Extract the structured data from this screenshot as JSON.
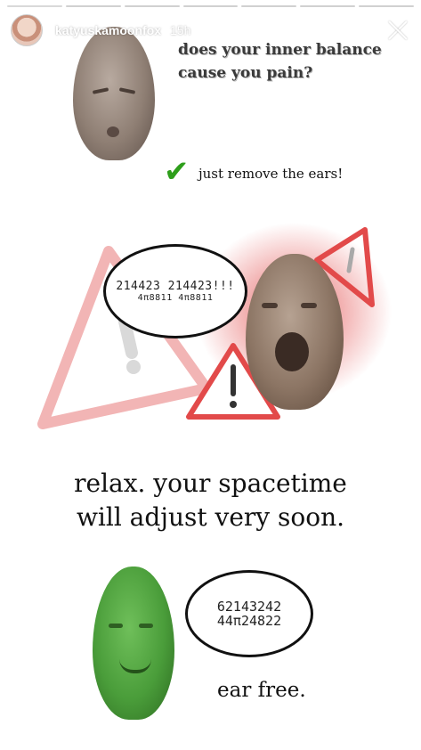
{
  "header": {
    "username": "katyuskamoonfox",
    "time_ago": "15h"
  },
  "progress_segments": [
    1,
    0,
    0,
    0,
    0,
    0,
    0
  ],
  "captions": {
    "top_line1": "does your inner balance",
    "top_line2": "cause you pain?",
    "remove": "just remove the ears!",
    "relax_line1": "relax. your spacetime",
    "relax_line2": "will adjust very soon.",
    "ear_free": "ear free."
  },
  "bubbles": {
    "bubble1_text": "214423 214423!!!",
    "bubble1_sub": "4π8811 4π8811",
    "bubble2_text": "62143242\n44π24822"
  },
  "icons": {
    "check": "✔",
    "close": "close-icon",
    "warning": "warning-triangle-icon"
  },
  "colors": {
    "warning_red": "#e24a4a",
    "check_green": "#2e9e1b",
    "green_head": "#4a9d3a"
  }
}
